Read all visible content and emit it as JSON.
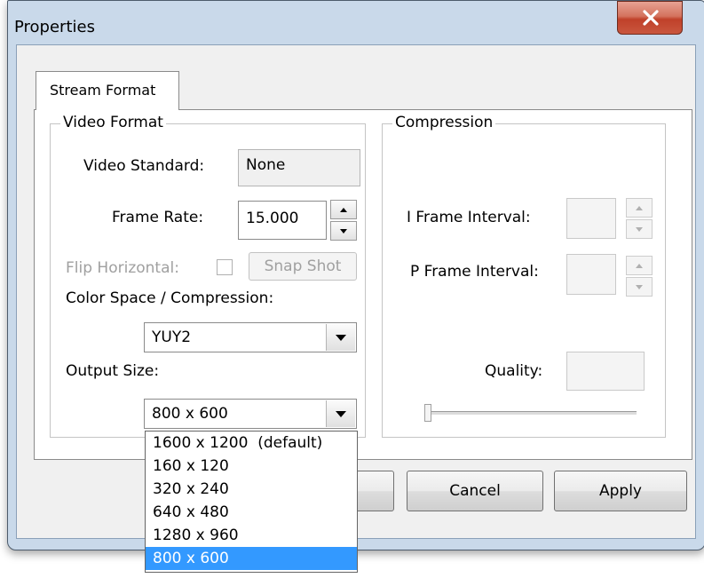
{
  "window": {
    "title": "Properties"
  },
  "tabs": [
    {
      "label": "Stream Format",
      "active": true
    }
  ],
  "video_format": {
    "group_title": "Video Format",
    "video_standard_label": "Video Standard:",
    "video_standard_value": "None",
    "frame_rate_label": "Frame Rate:",
    "frame_rate_value": "15.000",
    "flip_horizontal_label": "Flip Horizontal:",
    "flip_horizontal_checked": false,
    "snap_shot_label": "Snap Shot",
    "color_space_label": "Color Space / Compression:",
    "color_space_value": "YUY2",
    "output_size_label": "Output Size:",
    "output_size_value": "800 x 600",
    "output_size_options": [
      "1600 x 1200  (default)",
      "160 x 120",
      "320 x 240",
      "640 x 480",
      "1280 x 960",
      "800 x 600"
    ],
    "output_size_selected_index": 5
  },
  "compression": {
    "group_title": "Compression",
    "i_frame_label": "I Frame Interval:",
    "i_frame_value": "",
    "p_frame_label": "P Frame Interval:",
    "p_frame_value": "",
    "quality_label": "Quality:",
    "quality_value": "",
    "quality_slider_fraction": 0
  },
  "buttons": {
    "cancel": "Cancel",
    "apply": "Apply"
  },
  "colors": {
    "selection": "#3399ff",
    "close_button": "#c9563e",
    "frame": "#c9d9ea"
  },
  "icons": {
    "close": "close-icon",
    "spin_up": "arrow-up-icon",
    "spin_down": "arrow-down-icon",
    "dropdown": "chevron-down-icon"
  }
}
